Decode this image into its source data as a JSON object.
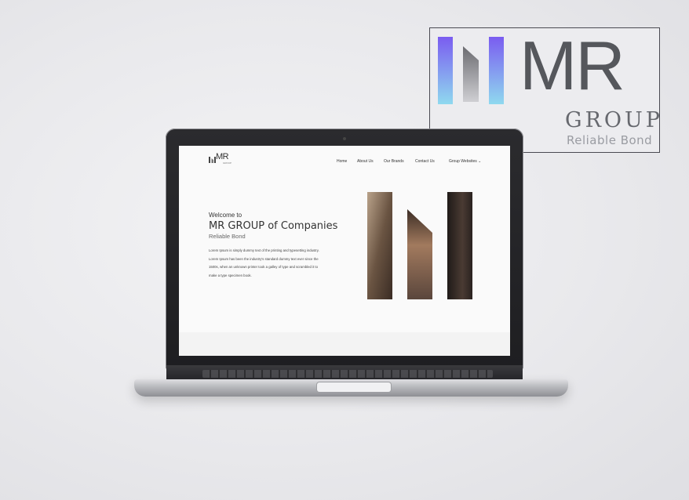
{
  "logo": {
    "wordmark": "MR",
    "group": "GROUP",
    "tagline": "Reliable Bond",
    "gradient_colors": [
      "#7a5cf0",
      "#8fd9ef"
    ]
  },
  "website": {
    "nav_items": [
      "Home",
      "About Us",
      "Our Brands",
      "Contact Us",
      "Group Websites"
    ],
    "nav_dropdown_icon": "chevron-down-icon",
    "logo_text": "MR",
    "logo_sub": "GROUP",
    "hero": {
      "welcome": "Welcome to",
      "title": "MR GROUP of Companies",
      "tagline": "Reliable Bond",
      "body": "Lorem Ipsum is simply dummy text of the printing and typesetting industry. Lorem Ipsum has been the industry's standard dummy text ever since the 1500s, when an unknown printer took a galley of type and scrambled it to make a type specimen book."
    }
  }
}
